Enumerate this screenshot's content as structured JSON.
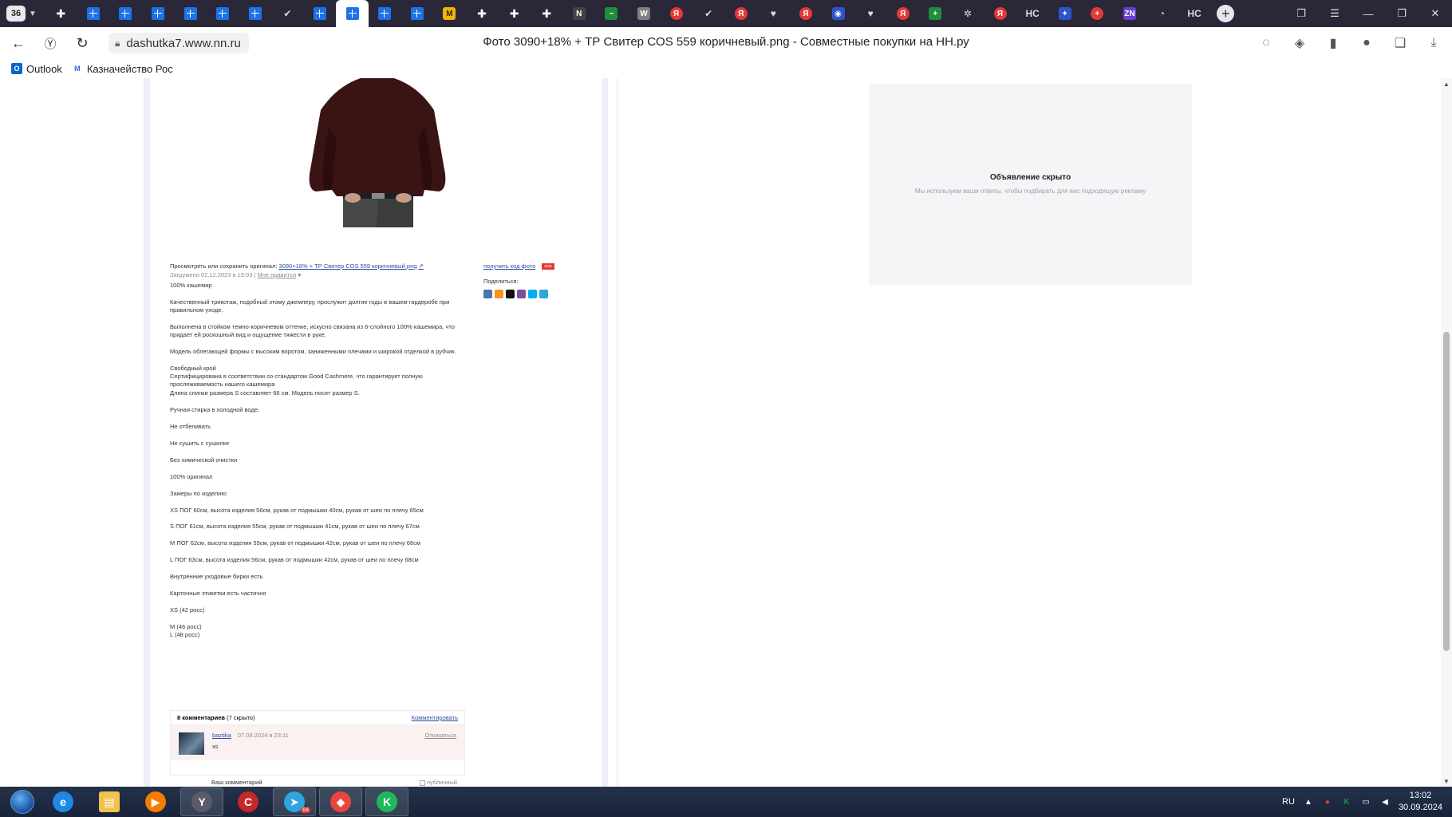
{
  "browser": {
    "tab_count": "36",
    "tabs": [
      {
        "kind": "star",
        "glyph": "✚"
      },
      {
        "kind": "win",
        "glyph": ""
      },
      {
        "kind": "win",
        "glyph": ""
      },
      {
        "kind": "win",
        "glyph": ""
      },
      {
        "kind": "win",
        "glyph": ""
      },
      {
        "kind": "win",
        "glyph": ""
      },
      {
        "kind": "win",
        "glyph": ""
      },
      {
        "kind": "pale",
        "glyph": "✔"
      },
      {
        "kind": "win",
        "glyph": ""
      },
      {
        "kind": "win",
        "glyph": "",
        "active": true
      },
      {
        "kind": "win",
        "glyph": ""
      },
      {
        "kind": "win",
        "glyph": ""
      },
      {
        "kind": "gold",
        "glyph": "M"
      },
      {
        "kind": "star",
        "glyph": "✚"
      },
      {
        "kind": "star",
        "glyph": "✚"
      },
      {
        "kind": "star",
        "glyph": "✚"
      },
      {
        "kind": "dark",
        "glyph": "N"
      },
      {
        "kind": "green",
        "glyph": "~"
      },
      {
        "kind": "grey",
        "glyph": "W"
      },
      {
        "kind": "ya",
        "glyph": "Я"
      },
      {
        "kind": "pale",
        "glyph": "✔"
      },
      {
        "kind": "ya",
        "glyph": "Я"
      },
      {
        "kind": "pale",
        "glyph": "♥"
      },
      {
        "kind": "ya",
        "glyph": "Я"
      },
      {
        "kind": "blue",
        "glyph": "◉"
      },
      {
        "kind": "pale",
        "glyph": "♥"
      },
      {
        "kind": "ya",
        "glyph": "Я"
      },
      {
        "kind": "green",
        "glyph": "+"
      },
      {
        "kind": "pale",
        "glyph": "✲"
      },
      {
        "kind": "ya",
        "glyph": "Я"
      },
      {
        "kind": "pale",
        "glyph": "HC"
      },
      {
        "kind": "blue",
        "glyph": "✦"
      },
      {
        "kind": "ya",
        "glyph": "+"
      },
      {
        "kind": "purple",
        "glyph": "ZN"
      },
      {
        "kind": "pale",
        "glyph": "◔"
      },
      {
        "kind": "pale",
        "glyph": "HC"
      }
    ],
    "new_tab_label": "+",
    "url": "dashutka7.www.nn.ru",
    "title": "Фото 3090+18% + ТР Свитер COS 559 коричневый.png - Совместные покупки на НН.ру",
    "bookmarks": [
      {
        "label": "Outlook",
        "icon": "outlook-icon",
        "color": "#0a64c8",
        "glyph": "O"
      },
      {
        "label": "Казначейство Рос",
        "icon": "treasury-icon",
        "color": "#2a6bd6",
        "glyph": "M"
      }
    ]
  },
  "photo": {
    "description_note": "",
    "sweater_color": "#3a1414"
  },
  "meta": {
    "view_prefix": "Просмотреть или сохранить оригинал:",
    "file_link": "3090+18% + ТР Свитер COS 559 коричневый.png",
    "uploaded": "Загружено 02.12.2023 в 19:03",
    "separator": "|",
    "like": "Мне нравится"
  },
  "share": {
    "get_code": "получить код фото",
    "new_badge": "new",
    "share_label": "Поделиться:",
    "icons": [
      {
        "name": "vk-icon",
        "color": "#4a76a8"
      },
      {
        "name": "ok-icon",
        "color": "#f7931e"
      },
      {
        "name": "x-icon",
        "color": "#111111"
      },
      {
        "name": "viber-icon",
        "color": "#7b519d"
      },
      {
        "name": "skype-icon",
        "color": "#00aff0"
      },
      {
        "name": "telegram-icon",
        "color": "#2ca5e0"
      }
    ]
  },
  "description": [
    {
      "text": "100% кашемир"
    },
    {
      "text": "Качественный трикотаж, подобный этому джемперу, прослужит долгие годы в вашем гардеробе при"
    },
    {
      "text": "правильном уходе."
    },
    {
      "text": "Выполнена в стойком темно-коричневом оттенке, искусно связана из 6-слойного 100% кашемира, что"
    },
    {
      "text": "придает ей роскошный вид и ощущение тяжести в руке."
    },
    {
      "text": "Модель облегающей формы с высоким воротом, заниженными плечами и широкой отделкой в рубчик."
    },
    {
      "text": "Свободный крой"
    },
    {
      "text": "Сертифицирована в соответствии со стандартом Good Cashmere, что гарантирует полную"
    },
    {
      "text": "прослеживаемость нашего кашемира"
    },
    {
      "text": "Длина спинки размера S составляет 66 см. Модель носит размер S."
    },
    {
      "text": "Ручная стирка в холодной воде."
    },
    {
      "text": "Не отбеливать"
    },
    {
      "text": "Не сушить с сушилке"
    },
    {
      "text": "Без химической очистки"
    },
    {
      "text": "100% оригинал"
    },
    {
      "text": "Замеры по изделию:"
    },
    {
      "text": "XS ПОГ 60см, высота изделия 56см, рукав от подмышки 40см, рукав от шеи по плечу 65см"
    },
    {
      "text": "S ПОГ 61см, высота изделия 55см, рукав от подмышки 41см, рукав от шеи по плечу 67см"
    },
    {
      "text": "M ПОГ 62см, высота изделия 55см, рукав от подмышки 42см, рукав от шеи по плечу 66см"
    },
    {
      "text": "L ПОГ 63см, высота изделия 56см, рукав от подмышки 42см, рукав от шеи по плечу 68см"
    },
    {
      "text": "Внутренние уходовые бирки есть"
    },
    {
      "text": "Картонные этикетки есть частично"
    },
    {
      "text": "XS (42 росс)"
    },
    {
      "text": "M (46 росс)"
    },
    {
      "text": "L (48 росс)"
    }
  ],
  "comments": {
    "count_label": "8 комментариев",
    "hidden_label": "(7 скрыто)",
    "comment_action": "Комментировать",
    "item": {
      "author": "baztika",
      "date": "07.09.2024 в 23:11",
      "text": "xs",
      "action": "Отказаться"
    },
    "your_comment_label": "Ваш комментарий",
    "public_label": "публичный"
  },
  "ad": {
    "title": "Объявление скрыто",
    "subtitle": "Мы используем ваши ответы, чтобы подбирать для вас подходящую рекламу"
  },
  "taskbar": {
    "apps": [
      {
        "name": "ie-icon",
        "color": "#1e88e5",
        "glyph": "e",
        "pinned": false
      },
      {
        "name": "folder-icon",
        "color": "#f2c14e",
        "glyph": "▤",
        "pinned": false
      },
      {
        "name": "media-player-icon",
        "color": "#f57c00",
        "glyph": "▶",
        "pinned": false
      },
      {
        "name": "yandex-browser-icon",
        "color": "#5a5a6a",
        "glyph": "Y",
        "pinned": true
      },
      {
        "name": "ccleaner-icon",
        "color": "#c62828",
        "glyph": "C",
        "pinned": false
      },
      {
        "name": "telegram-icon",
        "color": "#2ca5e0",
        "glyph": "➤",
        "pinned": true
      },
      {
        "name": "anydesk-icon",
        "color": "#e8453c",
        "glyph": "◆",
        "pinned": true
      },
      {
        "name": "kontur-icon",
        "color": "#1fb85a",
        "glyph": "K",
        "pinned": true
      }
    ],
    "telegram_badge": "64",
    "language": "RU",
    "time": "13:02",
    "date": "30.09.2024"
  }
}
